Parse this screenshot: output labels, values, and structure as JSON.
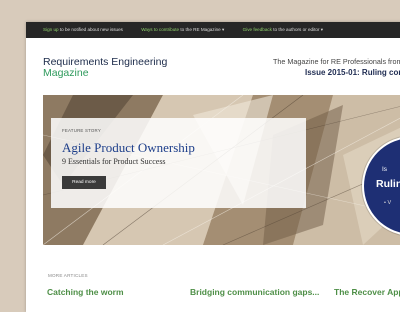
{
  "topbar": {
    "items": [
      {
        "link": "Sign up",
        "rest": " to be notified about new issues",
        "chevron": "▾"
      },
      {
        "link": "Ways to contribute",
        "rest": " to the RE Magazine",
        "chevron": "▾"
      },
      {
        "link": "Give feedback",
        "rest": " to the authors or editor",
        "chevron": "▾"
      }
    ]
  },
  "brand": {
    "line1": "Requirements Engineering",
    "line2": "Magazine"
  },
  "header": {
    "tagline": "The Magazine for RE Professionals from",
    "issue": "Issue 2015-01: Ruling comp"
  },
  "hero": {
    "label": "FEATURE STORY",
    "title": "Agile Product Ownership",
    "subtitle": "9 Essentials for Product Success",
    "button": "Read more"
  },
  "badge": {
    "line1": "Is",
    "line2": "Rulin",
    "line3": "• V"
  },
  "more_articles": {
    "label": "MORE ARTICLES",
    "items": [
      "Catching the worm",
      "Bridging communication gaps...",
      "The Recover Appro"
    ]
  },
  "colors": {
    "accent_green": "#2e9a5c",
    "navy": "#1c2b4a",
    "badge_blue": "#1e2f74"
  }
}
